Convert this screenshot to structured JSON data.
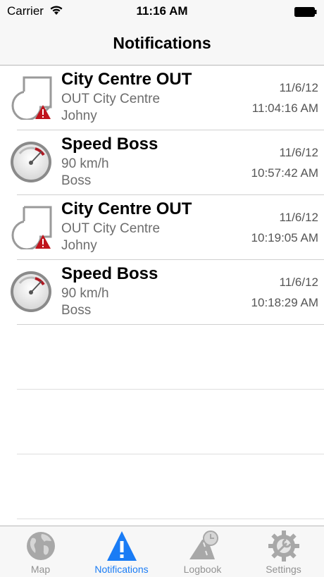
{
  "status_bar": {
    "carrier": "Carrier",
    "time": "11:16 AM"
  },
  "nav": {
    "title": "Notifications"
  },
  "notifications": [
    {
      "type": "zone-alert",
      "title": "City Centre OUT",
      "line1": "OUT City Centre",
      "line2": "Johny",
      "date": "11/6/12",
      "time": "11:04:16 AM"
    },
    {
      "type": "speed",
      "title": "Speed Boss",
      "line1": "90 km/h",
      "line2": "Boss",
      "date": "11/6/12",
      "time": "10:57:42 AM"
    },
    {
      "type": "zone-alert",
      "title": "City Centre OUT",
      "line1": "OUT City Centre",
      "line2": "Johny",
      "date": "11/6/12",
      "time": "10:19:05 AM"
    },
    {
      "type": "speed",
      "title": "Speed Boss",
      "line1": "90 km/h",
      "line2": "Boss",
      "date": "11/6/12",
      "time": "10:18:29 AM"
    }
  ],
  "tabs": [
    {
      "label": "Map",
      "icon": "globe-icon"
    },
    {
      "label": "Notifications",
      "icon": "warning-icon"
    },
    {
      "label": "Logbook",
      "icon": "road-clock-icon"
    },
    {
      "label": "Settings",
      "icon": "gear-wrench-icon"
    }
  ],
  "colors": {
    "active_tab": "#1a7cf5",
    "inactive_tab": "#929292",
    "alert_red": "#c0141c"
  }
}
